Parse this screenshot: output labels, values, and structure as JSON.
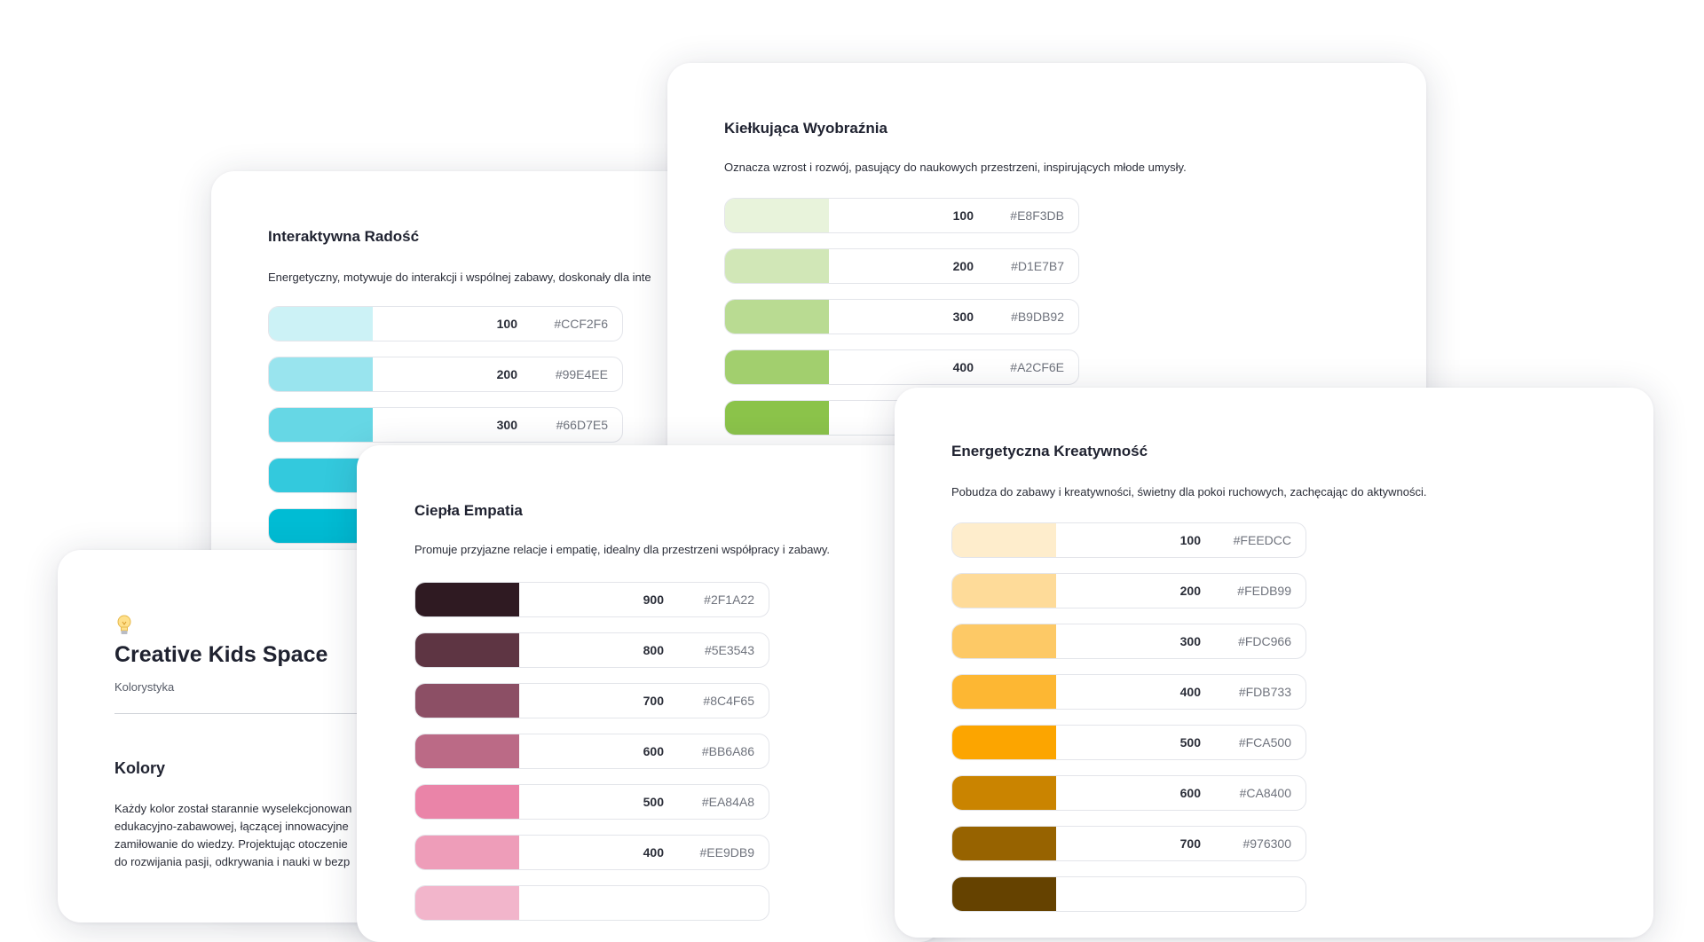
{
  "intro": {
    "icon": "lightbulb-icon",
    "title": "Creative Kids Space",
    "subtitle": "Kolorystyka",
    "heading": "Kolory",
    "lines": [
      "Każdy kolor został starannie wyselekcjonowan",
      "edukacyjno-zabawowej, łączącej innowacyjne",
      "zamiłowanie do wiedzy. Projektując otoczenie",
      "do rozwijania pasji, odkrywania i nauki w bezp"
    ]
  },
  "palettes": [
    {
      "title": "Interaktywna Radość",
      "description": "Energetyczny, motywuje do interakcji i wspólnej zabawy, doskonały dla inte",
      "swatches": [
        {
          "shade": "100",
          "hex": "#CCF2F6",
          "color": "#CCF2F6"
        },
        {
          "shade": "200",
          "hex": "#99E4EE",
          "color": "#99E4EE"
        },
        {
          "shade": "300",
          "hex": "#66D7E5",
          "color": "#66D7E5"
        },
        {
          "shade": "",
          "hex": "",
          "color": "#33C9DD"
        },
        {
          "shade": "",
          "hex": "",
          "color": "#00BCD4"
        }
      ]
    },
    {
      "title": "Kiełkująca Wyobraźnia",
      "description": "Oznacza wzrost i rozwój, pasujący do naukowych przestrzeni, inspirujących młode umysły.",
      "swatches": [
        {
          "shade": "100",
          "hex": "#E8F3DB",
          "color": "#E8F3DB"
        },
        {
          "shade": "200",
          "hex": "#D1E7B7",
          "color": "#D1E7B7"
        },
        {
          "shade": "300",
          "hex": "#B9DB92",
          "color": "#B9DB92"
        },
        {
          "shade": "400",
          "hex": "#A2CF6E",
          "color": "#A2CF6E"
        },
        {
          "shade": "",
          "hex": "",
          "color": "#8BC34A"
        }
      ]
    },
    {
      "title": "Ciepła Empatia",
      "description": "Promuje przyjazne relacje i empatię, idealny dla przestrzeni współpracy i zabawy.",
      "swatches": [
        {
          "shade": "900",
          "hex": "#2F1A22",
          "color": "#2F1A22"
        },
        {
          "shade": "800",
          "hex": "#5E3543",
          "color": "#5E3543"
        },
        {
          "shade": "700",
          "hex": "#8C4F65",
          "color": "#8C4F65"
        },
        {
          "shade": "600",
          "hex": "#BB6A86",
          "color": "#BB6A86"
        },
        {
          "shade": "500",
          "hex": "#EA84A8",
          "color": "#EA84A8"
        },
        {
          "shade": "400",
          "hex": "#EE9DB9",
          "color": "#EE9DB9"
        },
        {
          "shade": "",
          "hex": "",
          "color": "#F2B5CB"
        }
      ]
    },
    {
      "title": "Energetyczna Kreatywność",
      "description": "Pobudza do zabawy i kreatywności, świetny dla pokoi ruchowych, zachęcając do aktywności.",
      "swatches": [
        {
          "shade": "100",
          "hex": "#FEEDCC",
          "color": "#FEEDCC"
        },
        {
          "shade": "200",
          "hex": "#FEDB99",
          "color": "#FEDB99"
        },
        {
          "shade": "300",
          "hex": "#FDC966",
          "color": "#FDC966"
        },
        {
          "shade": "400",
          "hex": "#FDB733",
          "color": "#FDB733"
        },
        {
          "shade": "500",
          "hex": "#FCA500",
          "color": "#FCA500"
        },
        {
          "shade": "600",
          "hex": "#CA8400",
          "color": "#CA8400"
        },
        {
          "shade": "700",
          "hex": "#976300",
          "color": "#976300"
        },
        {
          "shade": "",
          "hex": "",
          "color": "#654200"
        }
      ]
    }
  ]
}
